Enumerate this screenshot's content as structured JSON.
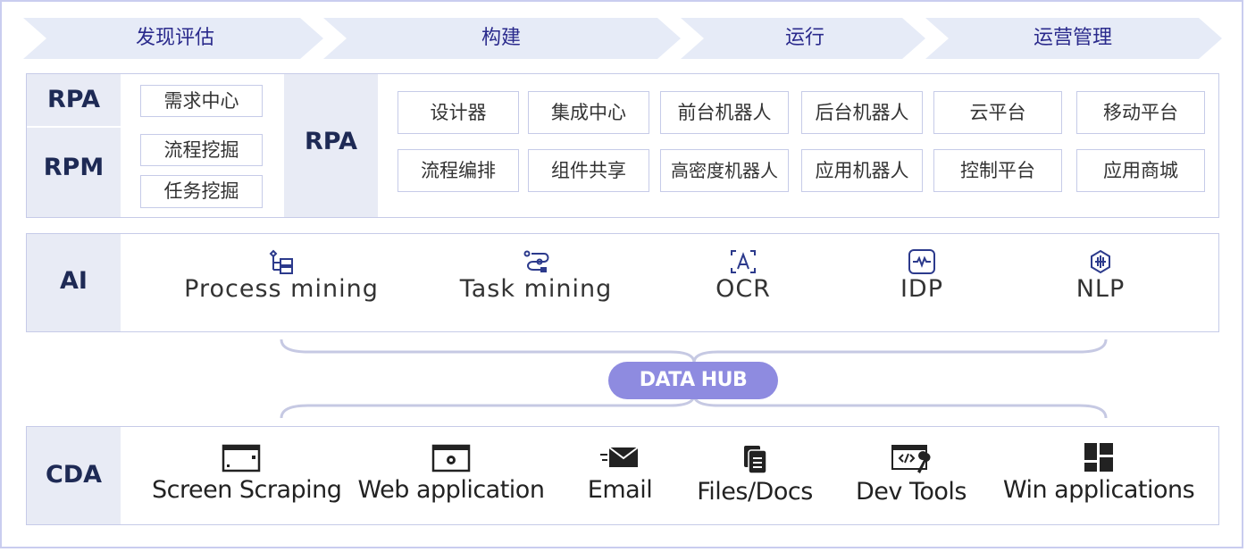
{
  "stages": [
    "发现评估",
    "构建",
    "运行",
    "运营管理"
  ],
  "rpa_rpm": {
    "rpa_label": "RPA",
    "rpm_label": "RPM",
    "rpa_items": [
      "需求中心"
    ],
    "rpm_items": [
      "流程挖掘",
      "任务挖掘"
    ],
    "rpa_center_label": "RPA",
    "rpa_modules_row1": [
      "设计器",
      "集成中心",
      "前台机器人",
      "后台机器人",
      "云平台",
      "移动平台"
    ],
    "rpa_modules_row2": [
      "流程编排",
      "组件共享",
      "高密度机器人",
      "应用机器人",
      "控制平台",
      "应用商城"
    ]
  },
  "ai": {
    "label": "AI",
    "items": [
      {
        "label": "Process mining",
        "icon": "process-tree-icon"
      },
      {
        "label": "Task mining",
        "icon": "task-flow-icon"
      },
      {
        "label": "OCR",
        "icon": "ocr-scan-icon"
      },
      {
        "label": "IDP",
        "icon": "idp-wave-icon"
      },
      {
        "label": "NLP",
        "icon": "nlp-network-icon"
      }
    ]
  },
  "hub": {
    "label": "DATA HUB"
  },
  "cda": {
    "label": "CDA",
    "items": [
      {
        "label": "Screen Scraping",
        "icon": "screen-icon"
      },
      {
        "label": "Web  application",
        "icon": "web-window-icon"
      },
      {
        "label": "Email",
        "icon": "email-icon"
      },
      {
        "label": "Files/Docs",
        "icon": "files-icon"
      },
      {
        "label": "Dev Tools",
        "icon": "dev-tools-icon"
      },
      {
        "label": "Win applications",
        "icon": "windows-tiles-icon"
      }
    ]
  },
  "colors": {
    "accent": "#8e8be0",
    "chevron": "#e6ebf7",
    "panel_gray": "#e8ebf5",
    "icon_blue": "#2c3a8c"
  }
}
